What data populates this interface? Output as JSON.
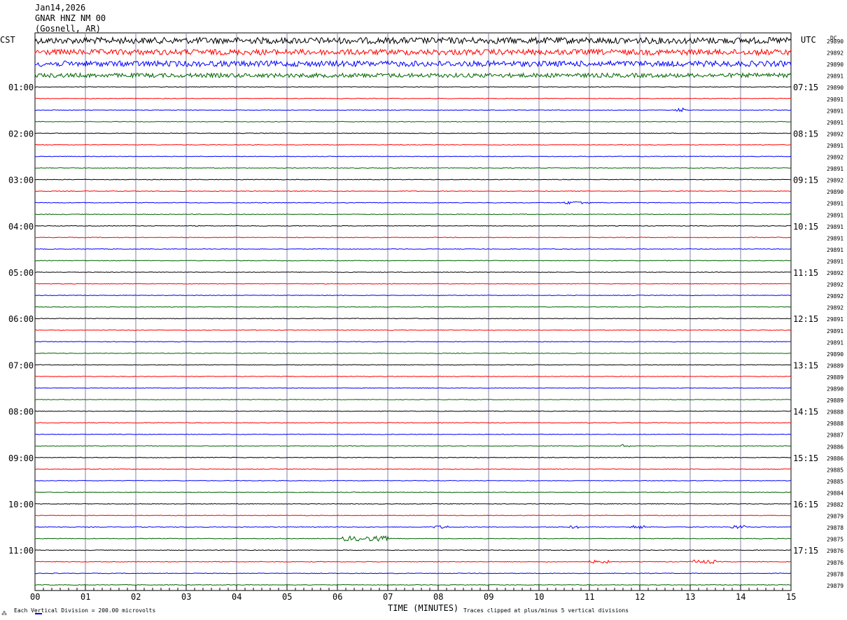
{
  "header": {
    "date": "Jan14,2026",
    "station": "GNAR HNZ NM 00",
    "location": "(Gosnell, AR)"
  },
  "left_tz": "CST",
  "right_tz": "UTC",
  "dc_label": "DC",
  "footer": {
    "division": "Each Vertical Division =  200.00 microvolts",
    "clipped": "Traces clipped at plus/minus 5 vertical divisions",
    "xlabel": "TIME (MINUTES)"
  },
  "colors": {
    "black": "#000000",
    "red": "#ff0000",
    "blue": "#0000ff",
    "green": "#006400",
    "grid": "#8080a0"
  },
  "chart_data": {
    "type": "line",
    "xlabel": "TIME (MINUTES)",
    "xlim": [
      0,
      15
    ],
    "xticks": [
      "00",
      "01",
      "02",
      "03",
      "04",
      "05",
      "06",
      "07",
      "08",
      "09",
      "10",
      "11",
      "12",
      "13",
      "14",
      "15"
    ],
    "trace_minutes": 15,
    "trace_colors": [
      "black",
      "red",
      "blue",
      "green"
    ],
    "rows": [
      {
        "dc": "29890"
      },
      {
        "dc": "29892"
      },
      {
        "dc": "29890"
      },
      {
        "dc": "29891"
      },
      {
        "cst": "01:00",
        "utc": "07:15",
        "dc": "29890"
      },
      {
        "dc": "29891"
      },
      {
        "dc": "29891"
      },
      {
        "dc": "29891"
      },
      {
        "cst": "02:00",
        "utc": "08:15",
        "dc": "29892"
      },
      {
        "dc": "29891"
      },
      {
        "dc": "29892"
      },
      {
        "dc": "29891"
      },
      {
        "cst": "03:00",
        "utc": "09:15",
        "dc": "29892"
      },
      {
        "dc": "29890"
      },
      {
        "dc": "29891"
      },
      {
        "dc": "29891"
      },
      {
        "cst": "04:00",
        "utc": "10:15",
        "dc": "29891"
      },
      {
        "dc": "29891"
      },
      {
        "dc": "29891"
      },
      {
        "dc": "29891"
      },
      {
        "cst": "05:00",
        "utc": "11:15",
        "dc": "29892"
      },
      {
        "dc": "29892"
      },
      {
        "dc": "29892"
      },
      {
        "dc": "29892"
      },
      {
        "cst": "06:00",
        "utc": "12:15",
        "dc": "29891"
      },
      {
        "dc": "29891"
      },
      {
        "dc": "29891"
      },
      {
        "dc": "29890"
      },
      {
        "cst": "07:00",
        "utc": "13:15",
        "dc": "29889"
      },
      {
        "dc": "29889"
      },
      {
        "dc": "29890"
      },
      {
        "dc": "29889"
      },
      {
        "cst": "08:00",
        "utc": "14:15",
        "dc": "29888"
      },
      {
        "dc": "29888"
      },
      {
        "dc": "29887"
      },
      {
        "dc": "29886"
      },
      {
        "cst": "09:00",
        "utc": "15:15",
        "dc": "29886"
      },
      {
        "dc": "29885"
      },
      {
        "dc": "29885"
      },
      {
        "dc": "29884"
      },
      {
        "cst": "10:00",
        "utc": "16:15",
        "dc": "29882"
      },
      {
        "dc": "29879"
      },
      {
        "dc": "29878"
      },
      {
        "dc": "29875"
      },
      {
        "cst": "11:00",
        "utc": "17:15",
        "dc": "29876"
      },
      {
        "dc": "29876"
      },
      {
        "dc": "29878"
      },
      {
        "dc": "29879"
      }
    ],
    "events": [
      {
        "row": 0,
        "t0": 0.0,
        "t1": 15.0,
        "amp": 4.5
      },
      {
        "row": 1,
        "t0": 0.0,
        "t1": 15.0,
        "amp": 4.0
      },
      {
        "row": 2,
        "t0": 0.0,
        "t1": 15.0,
        "amp": 4.0
      },
      {
        "row": 3,
        "t0": 0.0,
        "t1": 15.0,
        "amp": 3.0
      },
      {
        "row": 6,
        "t0": 12.7,
        "t1": 12.9,
        "amp": 3.0
      },
      {
        "row": 14,
        "t0": 10.5,
        "t1": 11.0,
        "amp": 2.0
      },
      {
        "row": 35,
        "t0": 11.6,
        "t1": 11.8,
        "amp": 2.0
      },
      {
        "row": 42,
        "t0": 7.9,
        "t1": 8.2,
        "amp": 2.0
      },
      {
        "row": 42,
        "t0": 10.6,
        "t1": 10.8,
        "amp": 2.0
      },
      {
        "row": 42,
        "t0": 11.8,
        "t1": 12.1,
        "amp": 2.5
      },
      {
        "row": 42,
        "t0": 13.8,
        "t1": 14.1,
        "amp": 2.5
      },
      {
        "row": 43,
        "t0": 6.1,
        "t1": 7.0,
        "amp": 3.5
      },
      {
        "row": 45,
        "t0": 11.0,
        "t1": 11.4,
        "amp": 2.0
      },
      {
        "row": 45,
        "t0": 13.0,
        "t1": 13.5,
        "amp": 2.5
      }
    ]
  }
}
